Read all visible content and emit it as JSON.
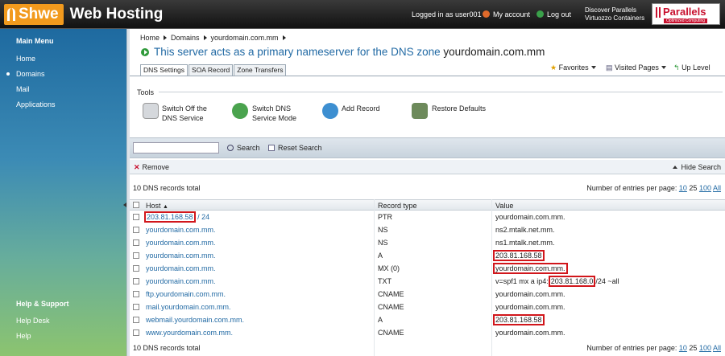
{
  "header": {
    "logo_brand": "Shwe",
    "logo_text": "Web Hosting",
    "logged_in": "Logged in as user001",
    "my_account": "My account",
    "log_out": "Log out",
    "discover_line1": "Discover Parallels",
    "discover_line2": "Virtuozzo Containers",
    "parallels": "Parallels",
    "parallels_tag": "Optimized Computing"
  },
  "sidebar": {
    "main_menu": "Main Menu",
    "items": [
      "Home",
      "Domains",
      "Mail",
      "Applications"
    ],
    "help_support": "Help & Support",
    "help_items": [
      "Help Desk",
      "Help"
    ]
  },
  "breadcrumb": [
    "Home",
    "Domains",
    "yourdomain.com.mm"
  ],
  "title_prefix": "This server acts as a primary nameserver for the DNS zone",
  "title_domain": "yourdomain.com.mm",
  "toplinks": {
    "favorites": "Favorites",
    "visited_pages": "Visited Pages",
    "up_level": "Up Level"
  },
  "tabs": [
    "DNS Settings",
    "SOA Record",
    "Zone Transfers"
  ],
  "tools": {
    "label": "Tools",
    "switch_off_1": "Switch Off the",
    "switch_off_2": "DNS Service",
    "switch_mode_1": "Switch DNS",
    "switch_mode_2": "Service Mode",
    "add_record": "Add Record",
    "restore_defaults": "Restore Defaults"
  },
  "search": {
    "value": "",
    "search_label": "Search",
    "reset_label": "Reset Search"
  },
  "actions": {
    "remove": "Remove",
    "hide_search": "Hide Search"
  },
  "list": {
    "total": "10 DNS records total",
    "per_page_label": "Number of entries per page:",
    "per_page_options": [
      "10",
      "25",
      "100",
      "All"
    ],
    "columns": {
      "host": "Host",
      "type": "Record type",
      "value": "Value"
    },
    "rows": [
      {
        "host": "203.81.168.58",
        "host_suffix": "/ 24",
        "type": "PTR",
        "value": "yourdomain.com.mm."
      },
      {
        "host": "yourdomain.com.mm.",
        "type": "NS",
        "value": "ns2.mtalk.net.mm."
      },
      {
        "host": "yourdomain.com.mm.",
        "type": "NS",
        "value": "ns1.mtalk.net.mm."
      },
      {
        "host": "yourdomain.com.mm.",
        "type": "A",
        "value": "203.81.168.58"
      },
      {
        "host": "yourdomain.com.mm.",
        "type": "MX (0)",
        "value": "yourdomain.com.mm."
      },
      {
        "host": "yourdomain.com.mm.",
        "type": "TXT",
        "value_pre": "v=spf1 mx a ip4:",
        "value_hl": "203.81.168.0",
        "value_post": "/24 ~all"
      },
      {
        "host": "ftp.yourdomain.com.mm.",
        "type": "CNAME",
        "value": "yourdomain.com.mm."
      },
      {
        "host": "mail.yourdomain.com.mm.",
        "type": "CNAME",
        "value": "yourdomain.com.mm."
      },
      {
        "host": "webmail.yourdomain.com.mm.",
        "type": "A",
        "value": "203.81.168.58"
      },
      {
        "host": "www.yourdomain.com.mm.",
        "type": "CNAME",
        "value": "yourdomain.com.mm."
      }
    ]
  },
  "colors": {
    "link": "#226aa4",
    "highlight": "#d1161b",
    "brand_orange": "#f29a1d"
  }
}
